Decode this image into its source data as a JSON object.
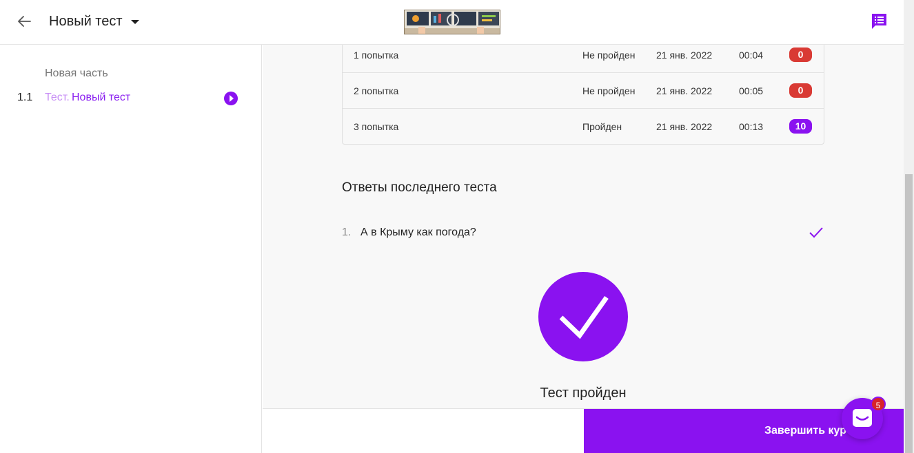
{
  "header": {
    "title": "Новый тест"
  },
  "sidebar": {
    "section_title": "Новая часть",
    "lesson": {
      "number": "1.1",
      "prefix": "Тест.",
      "name": "Новый тест"
    }
  },
  "attempts": [
    {
      "name": "1 попытка",
      "status": "Не пройден",
      "date": "21 янв. 2022",
      "time": "00:04",
      "score": "0",
      "score_color": "#d93a34"
    },
    {
      "name": "2 попытка",
      "status": "Не пройден",
      "date": "21 янв. 2022",
      "time": "00:05",
      "score": "0",
      "score_color": "#d93a34"
    },
    {
      "name": "3 попытка",
      "status": "Пройден",
      "date": "21 янв. 2022",
      "time": "00:13",
      "score": "10",
      "score_color": "#8a12f0"
    }
  ],
  "answers": {
    "title": "Ответы последнего теста",
    "questions": [
      {
        "number": "1.",
        "text": "А в Крыму как погода?"
      }
    ]
  },
  "result": {
    "text": "Тест пройден"
  },
  "footer": {
    "finish_label": "Завершить курс"
  },
  "chat": {
    "badge_count": "5"
  },
  "colors": {
    "accent": "#8a12f0",
    "fail": "#d93a34",
    "background": "#f8f8f8"
  }
}
